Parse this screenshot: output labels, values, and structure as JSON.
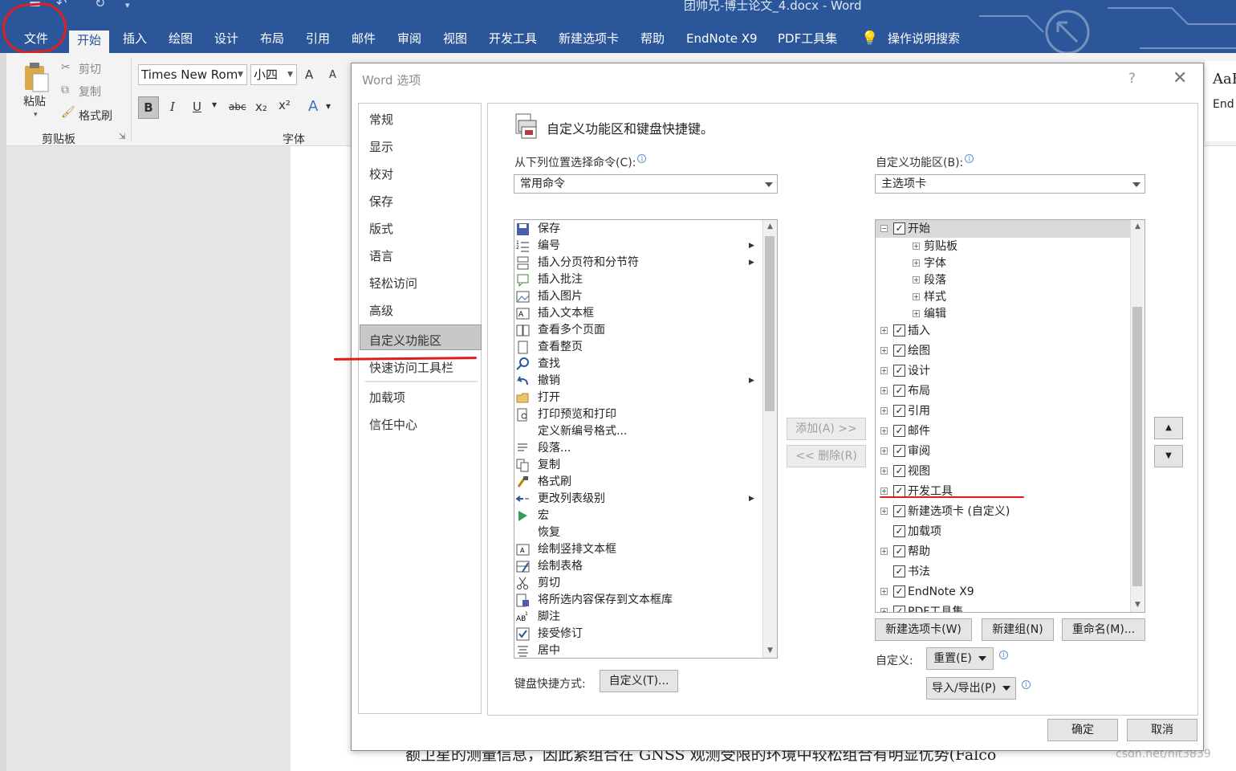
{
  "window": {
    "title": "团帅兄-博士论文_4.docx  -  Word"
  },
  "tabs": [
    {
      "label": "文件"
    },
    {
      "label": "开始"
    },
    {
      "label": "插入"
    },
    {
      "label": "绘图"
    },
    {
      "label": "设计"
    },
    {
      "label": "布局"
    },
    {
      "label": "引用"
    },
    {
      "label": "邮件"
    },
    {
      "label": "审阅"
    },
    {
      "label": "视图"
    },
    {
      "label": "开发工具"
    },
    {
      "label": "新建选项卡"
    },
    {
      "label": "帮助"
    },
    {
      "label": "EndNote X9"
    },
    {
      "label": "PDF工具集"
    },
    {
      "label": "操作说明搜索"
    }
  ],
  "ribbon": {
    "paste": "粘贴",
    "cut": "剪切",
    "copy": "复制",
    "format_painter": "格式刷",
    "clipboard_group": "剪贴板",
    "font_group": "字体",
    "font_name": "Times New Rom",
    "font_size": "小四",
    "grow": "A",
    "shrink": "A",
    "bold": "B",
    "italic": "I",
    "underline": "U",
    "strike": "abc",
    "subscript": "x₂",
    "superscript": "x²",
    "text_effects": "A"
  },
  "styles_panel": {
    "preview": "AaB",
    "name": "End"
  },
  "document": {
    "visible_text": "额卫星的测量信息，因此紧组合在 GNSS 观测受限的环境中较松组合有明显优势(Falco",
    "watermark": "csdn.net/hit3839"
  },
  "dialog": {
    "title": "Word 选项",
    "help": "?",
    "close": "✕",
    "nav": [
      "常规",
      "显示",
      "校对",
      "保存",
      "版式",
      "语言",
      "轻松访问",
      "高级",
      "自定义功能区",
      "快速访问工具栏",
      "加载项",
      "信任中心"
    ],
    "selected_nav": "自定义功能区",
    "header": "自定义功能区和键盘快捷键。",
    "choose_label": "从下列位置选择命令(C):",
    "choose_value": "常用命令",
    "customize_label": "自定义功能区(B):",
    "customize_value": "主选项卡",
    "commands": [
      {
        "label": "保存",
        "icon": "save-icon",
        "sub": false
      },
      {
        "label": "编号",
        "icon": "numbering-icon",
        "sub": true
      },
      {
        "label": "插入分页符和分节符",
        "icon": "page-break-icon",
        "sub": true
      },
      {
        "label": "插入批注",
        "icon": "comment-icon",
        "sub": false
      },
      {
        "label": "插入图片",
        "icon": "picture-icon",
        "sub": false
      },
      {
        "label": "插入文本框",
        "icon": "textbox-icon",
        "sub": false
      },
      {
        "label": "查看多个页面",
        "icon": "multipage-icon",
        "sub": false
      },
      {
        "label": "查看整页",
        "icon": "onepage-icon",
        "sub": false
      },
      {
        "label": "查找",
        "icon": "find-icon",
        "sub": false
      },
      {
        "label": "撤销",
        "icon": "undo-icon",
        "sub": true
      },
      {
        "label": "打开",
        "icon": "open-folder-icon",
        "sub": false
      },
      {
        "label": "打印预览和打印",
        "icon": "print-preview-icon",
        "sub": false
      },
      {
        "label": "定义新编号格式...",
        "icon": "",
        "sub": false
      },
      {
        "label": "段落...",
        "icon": "paragraph-icon",
        "sub": false
      },
      {
        "label": "复制",
        "icon": "copy-icon",
        "sub": false
      },
      {
        "label": "格式刷",
        "icon": "format-painter-icon",
        "sub": false
      },
      {
        "label": "更改列表级别",
        "icon": "list-level-icon",
        "sub": true
      },
      {
        "label": "宏",
        "icon": "macro-icon",
        "sub": false
      },
      {
        "label": "恢复",
        "icon": "",
        "sub": false
      },
      {
        "label": "绘制竖排文本框",
        "icon": "vertical-textbox-icon",
        "sub": false
      },
      {
        "label": "绘制表格",
        "icon": "draw-table-icon",
        "sub": false
      },
      {
        "label": "剪切",
        "icon": "cut-icon",
        "sub": false
      },
      {
        "label": "将所选内容保存到文本框库",
        "icon": "save-textbox-icon",
        "sub": false
      },
      {
        "label": "脚注",
        "icon": "footnote-icon",
        "sub": false
      },
      {
        "label": "接受修订",
        "icon": "accept-icon",
        "sub": false
      },
      {
        "label": "居中",
        "icon": "center-icon",
        "sub": false
      }
    ],
    "ribbon_tree": [
      {
        "label": "开始",
        "level": 0,
        "expander": "⊟",
        "checked": true,
        "selected": true
      },
      {
        "label": "剪贴板",
        "level": 1,
        "expander": "⊞",
        "checked": false,
        "selected": false
      },
      {
        "label": "字体",
        "level": 1,
        "expander": "⊞",
        "checked": false,
        "selected": false
      },
      {
        "label": "段落",
        "level": 1,
        "expander": "⊞",
        "checked": false,
        "selected": false
      },
      {
        "label": "样式",
        "level": 1,
        "expander": "⊞",
        "checked": false,
        "selected": false
      },
      {
        "label": "编辑",
        "level": 1,
        "expander": "⊞",
        "checked": false,
        "selected": false
      },
      {
        "label": "插入",
        "level": 0,
        "expander": "⊞",
        "checked": true,
        "selected": false
      },
      {
        "label": "绘图",
        "level": 0,
        "expander": "⊞",
        "checked": true,
        "selected": false
      },
      {
        "label": "设计",
        "level": 0,
        "expander": "⊞",
        "checked": true,
        "selected": false
      },
      {
        "label": "布局",
        "level": 0,
        "expander": "⊞",
        "checked": true,
        "selected": false
      },
      {
        "label": "引用",
        "level": 0,
        "expander": "⊞",
        "checked": true,
        "selected": false
      },
      {
        "label": "邮件",
        "level": 0,
        "expander": "⊞",
        "checked": true,
        "selected": false
      },
      {
        "label": "审阅",
        "level": 0,
        "expander": "⊞",
        "checked": true,
        "selected": false
      },
      {
        "label": "视图",
        "level": 0,
        "expander": "⊞",
        "checked": true,
        "selected": false
      },
      {
        "label": "开发工具",
        "level": 0,
        "expander": "⊞",
        "checked": true,
        "selected": false
      },
      {
        "label": "新建选项卡 (自定义)",
        "level": 0,
        "expander": "⊞",
        "checked": true,
        "selected": false
      },
      {
        "label": "加载项",
        "level": 0,
        "expander": "",
        "checked": true,
        "selected": false
      },
      {
        "label": "帮助",
        "level": 0,
        "expander": "⊞",
        "checked": true,
        "selected": false
      },
      {
        "label": "书法",
        "level": 0,
        "expander": "",
        "checked": true,
        "selected": false
      },
      {
        "label": "EndNote X9",
        "level": 0,
        "expander": "⊞",
        "checked": true,
        "selected": false
      },
      {
        "label": "PDF工具集",
        "level": 0,
        "expander": "⊞",
        "checked": true,
        "selected": false
      }
    ],
    "add_button": "添加(A) >>",
    "remove_button": "<< 删除(R)",
    "new_tab_button": "新建选项卡(W)",
    "new_group_button": "新建组(N)",
    "rename_button": "重命名(M)...",
    "customize_label2": "自定义:",
    "reset_button": "重置(E)",
    "import_export_button": "导入/导出(P)",
    "keyboard_label": "键盘快捷方式:",
    "keyboard_button": "自定义(T)...",
    "ok_button": "确定",
    "cancel_button": "取消"
  },
  "colors": {
    "titlebar": "#2b579a",
    "annotation_red": "#e01b1b"
  }
}
